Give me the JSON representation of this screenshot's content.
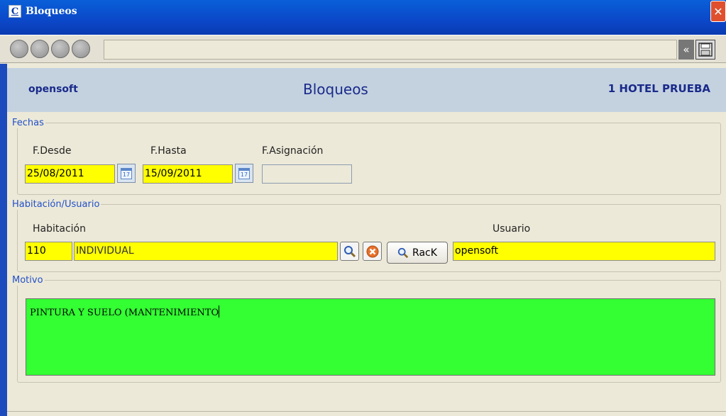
{
  "window": {
    "title": "Bloqueos",
    "app_icon_letter": "C",
    "close": "✕"
  },
  "toolbar": {
    "collapse_glyph": "«",
    "save_icon": "floppy-disk-icon"
  },
  "header": {
    "company": "opensoft",
    "screen_title": "Bloqueos",
    "hotel": "1 HOTEL PRUEBA"
  },
  "fechas": {
    "legend": "Fechas",
    "desde_label": "F.Desde",
    "desde_value": "25/08/2011",
    "hasta_label": "F.Hasta",
    "hasta_value": "15/09/2011",
    "asignacion_label": "F.Asignación",
    "asignacion_value": "",
    "calendar_day": "17"
  },
  "habitacion_usuario": {
    "legend": "Habitación/Usuario",
    "habitacion_label": "Habitación",
    "habitacion_number": "110",
    "habitacion_type": "INDIVIDUAL",
    "rack_label": "RacK",
    "usuario_label": "Usuario",
    "usuario_value": "opensoft"
  },
  "motivo": {
    "legend": "Motivo",
    "text": "PINTURA Y SUELO (MANTENIMIENTO"
  },
  "colors": {
    "required_field": "#ffff00",
    "motivo_bg": "#33ff33",
    "header_text": "#1a2a8a"
  }
}
